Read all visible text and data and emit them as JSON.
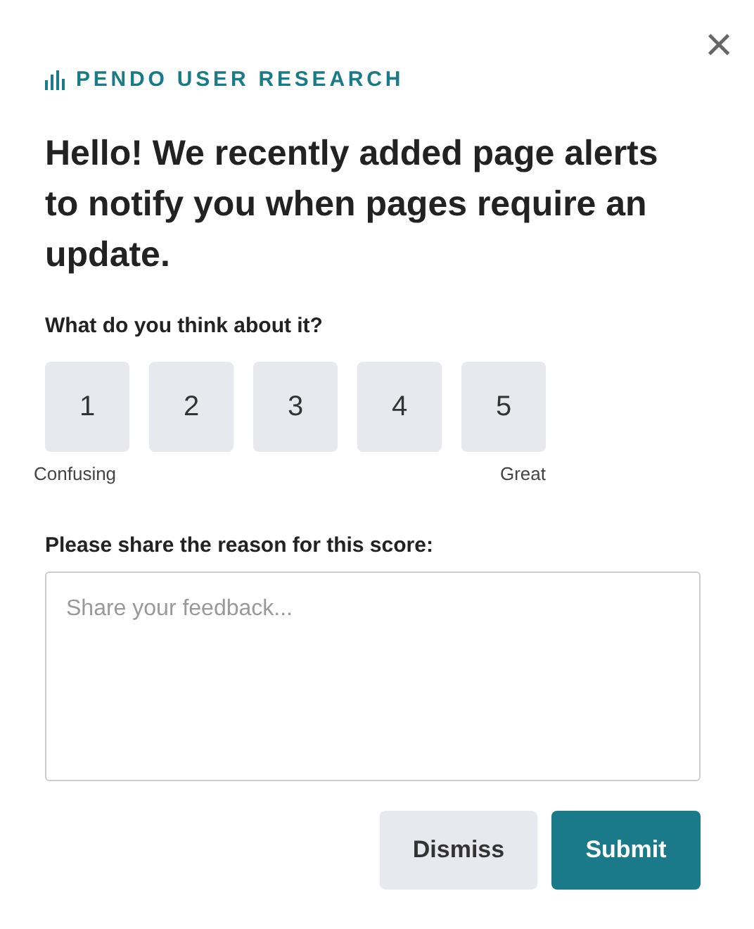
{
  "brand": "PENDO USER RESEARCH",
  "close": "×",
  "heading": "Hello! We recently added page alerts to notify you when pages require an update.",
  "question": "What do you think about it?",
  "scale": [
    {
      "label": "1",
      "selected": false
    },
    {
      "label": "2",
      "selected": false
    },
    {
      "label": "3",
      "selected": false
    },
    {
      "label": "4",
      "selected": false
    },
    {
      "label": "5",
      "selected": false
    }
  ],
  "scale_low": "Confusing",
  "scale_high": "Great",
  "reason_label": "Please share the reason for this score:",
  "feedback": {
    "placeholder": "Share your feedback..."
  },
  "buttons": [
    {
      "label": "Dismiss",
      "kind": "secondary"
    },
    {
      "label": "Submit",
      "kind": "primary"
    }
  ]
}
